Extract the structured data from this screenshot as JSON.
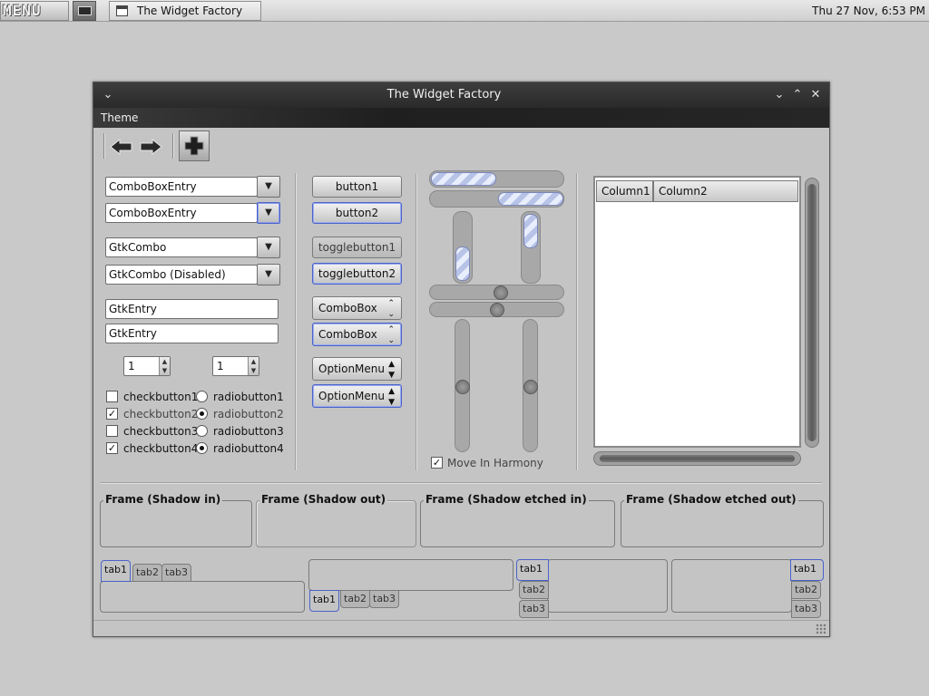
{
  "panel": {
    "menu_label": "MENU",
    "task_label": "The Widget Factory",
    "clock": "Thu 27 Nov,  6:53 PM"
  },
  "window": {
    "title": "The Widget Factory",
    "menubar": {
      "theme": "Theme"
    },
    "toolbar": {
      "icons": [
        "back-arrow-icon",
        "forward-arrow-icon",
        "add-icon"
      ]
    },
    "left_column": {
      "combobox_entries": [
        {
          "value": "ComboBoxEntry"
        },
        {
          "value": "ComboBoxEntry"
        }
      ],
      "gtk_combos": [
        {
          "value": "GtkCombo"
        },
        {
          "value": "GtkCombo (Disabled)"
        }
      ],
      "entries": [
        {
          "value": "GtkEntry"
        },
        {
          "value": "GtkEntry"
        }
      ],
      "spinbuttons": [
        {
          "value": "1"
        },
        {
          "value": "1"
        }
      ],
      "checkbuttons": [
        {
          "label": "checkbutton1",
          "checked": false,
          "check_mark": ""
        },
        {
          "label": "checkbutton2",
          "checked": true,
          "check_mark": "✓"
        },
        {
          "label": "checkbutton3",
          "checked": false,
          "check_mark": ""
        },
        {
          "label": "checkbutton4",
          "checked": true,
          "check_mark": "✓"
        }
      ],
      "radiobuttons": [
        {
          "label": "radiobutton1",
          "selected": false
        },
        {
          "label": "radiobutton2",
          "selected": true
        },
        {
          "label": "radiobutton3",
          "selected": false
        },
        {
          "label": "radiobutton4",
          "selected": true
        }
      ]
    },
    "buttons_column": {
      "buttons": [
        "button1",
        "button2"
      ],
      "togglebuttons": [
        "togglebutton1",
        "togglebutton2"
      ],
      "comboboxes": [
        "ComboBox",
        "ComboBox"
      ],
      "optionmenus": [
        "OptionMenu",
        "OptionMenu"
      ]
    },
    "range_column": {
      "move_in_harmony": {
        "label": "Move In Harmony",
        "checked": true,
        "check_mark": "✓"
      }
    },
    "treeview": {
      "columns": [
        "Column1",
        "Column2"
      ]
    },
    "frames": [
      {
        "label": "Frame (Shadow in)"
      },
      {
        "label": "Frame (Shadow out)"
      },
      {
        "label": "Frame (Shadow etched in)"
      },
      {
        "label": "Frame (Shadow etched out)"
      }
    ],
    "notebooks": [
      {
        "position": "top",
        "tabs": [
          "tab1",
          "tab2",
          "tab3"
        ],
        "active": "tab1"
      },
      {
        "position": "bottom",
        "tabs": [
          "tab1",
          "tab2",
          "tab3"
        ],
        "active": "tab1"
      },
      {
        "position": "left",
        "tabs": [
          "tab1",
          "tab2",
          "tab3"
        ],
        "active": "tab1"
      },
      {
        "position": "right",
        "tabs": [
          "tab1",
          "tab2",
          "tab3"
        ],
        "active": "tab1"
      }
    ]
  },
  "colors": {
    "desktop": "#c9c9c9",
    "titlebar": "#2f2f2f",
    "focus_accent": "#4a63c9",
    "progress_stripe": "#b8c3e8"
  }
}
